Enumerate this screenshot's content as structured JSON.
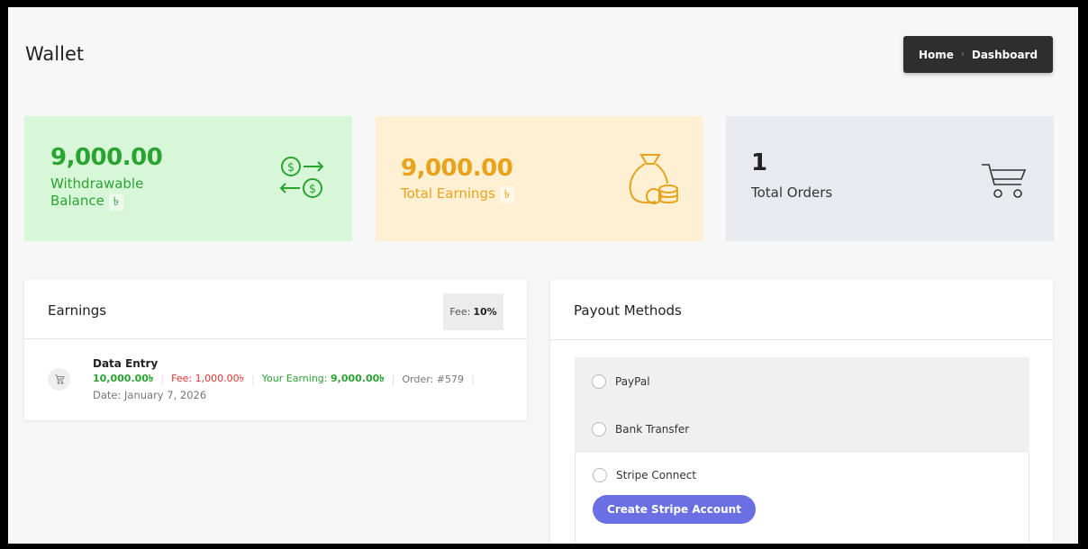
{
  "page": {
    "title": "Wallet"
  },
  "breadcrumb": {
    "home": "Home",
    "separator": "›",
    "current": "Dashboard"
  },
  "stats": {
    "withdrawable": {
      "value": "9,000.00",
      "label_line1": "Withdrawable",
      "label_line2": "Balance",
      "currency": "৳",
      "color": "#2aa431",
      "icon": "money-exchange-icon"
    },
    "earnings": {
      "value": "9,000.00",
      "label": "Total Earnings",
      "currency": "৳",
      "color": "#e9a21b",
      "icon": "money-bag-icon"
    },
    "orders": {
      "value": "1",
      "label": "Total Orders",
      "icon": "cart-icon"
    }
  },
  "earnings_card": {
    "title": "Earnings",
    "fee_label": "Fee:",
    "fee_value": "10%",
    "entries": [
      {
        "name": "Data Entry",
        "amount": "10,000.00৳",
        "fee": "Fee: 1,000.00৳",
        "your_earning_label": "Your Earning:",
        "your_earning_value": "9,000.00৳",
        "order": "Order: #579",
        "date": "Date: January 7, 2026"
      }
    ]
  },
  "payout_card": {
    "title": "Payout Methods",
    "methods": [
      {
        "label": "PayPal"
      },
      {
        "label": "Bank Transfer"
      },
      {
        "label": "Stripe Connect",
        "button": "Create Stripe Account"
      }
    ]
  }
}
